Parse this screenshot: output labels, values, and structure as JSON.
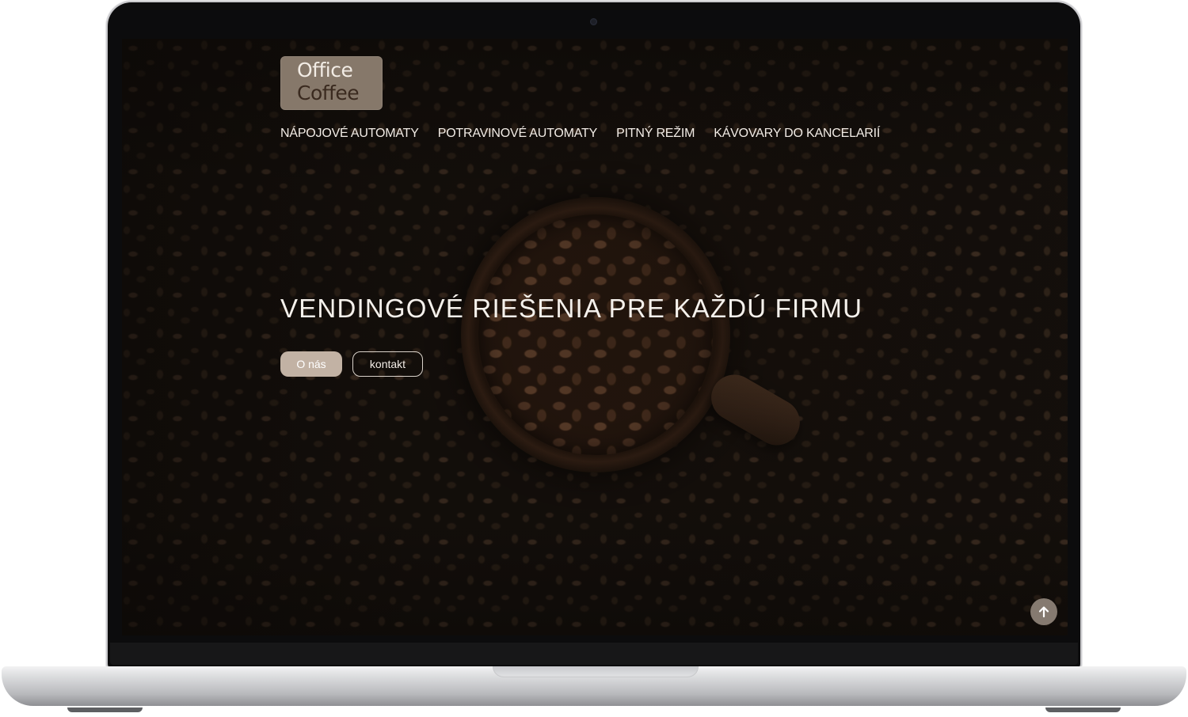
{
  "logo": {
    "line1": "Office",
    "line2": "Coffee"
  },
  "nav": {
    "items": [
      {
        "label": "NÁPOJOVÉ AUTOMATY"
      },
      {
        "label": "POTRAVINOVÉ AUTOMATY"
      },
      {
        "label": "PITNÝ REŽIM"
      },
      {
        "label": "KÁVOVARY DO KANCELARIÍ"
      }
    ]
  },
  "hero": {
    "title": "VENDINGOVÉ RIEŠENIA PRE KAŽDÚ FIRMU",
    "buttons": {
      "about": "O nás",
      "contact": "kontakt"
    }
  },
  "icons": {
    "scroll_top": "arrow-up-icon"
  },
  "colors": {
    "button_primary_bg": "#c2b2a4",
    "logo_bg": "#86786a",
    "scroll_top_bg": "#857a70"
  }
}
